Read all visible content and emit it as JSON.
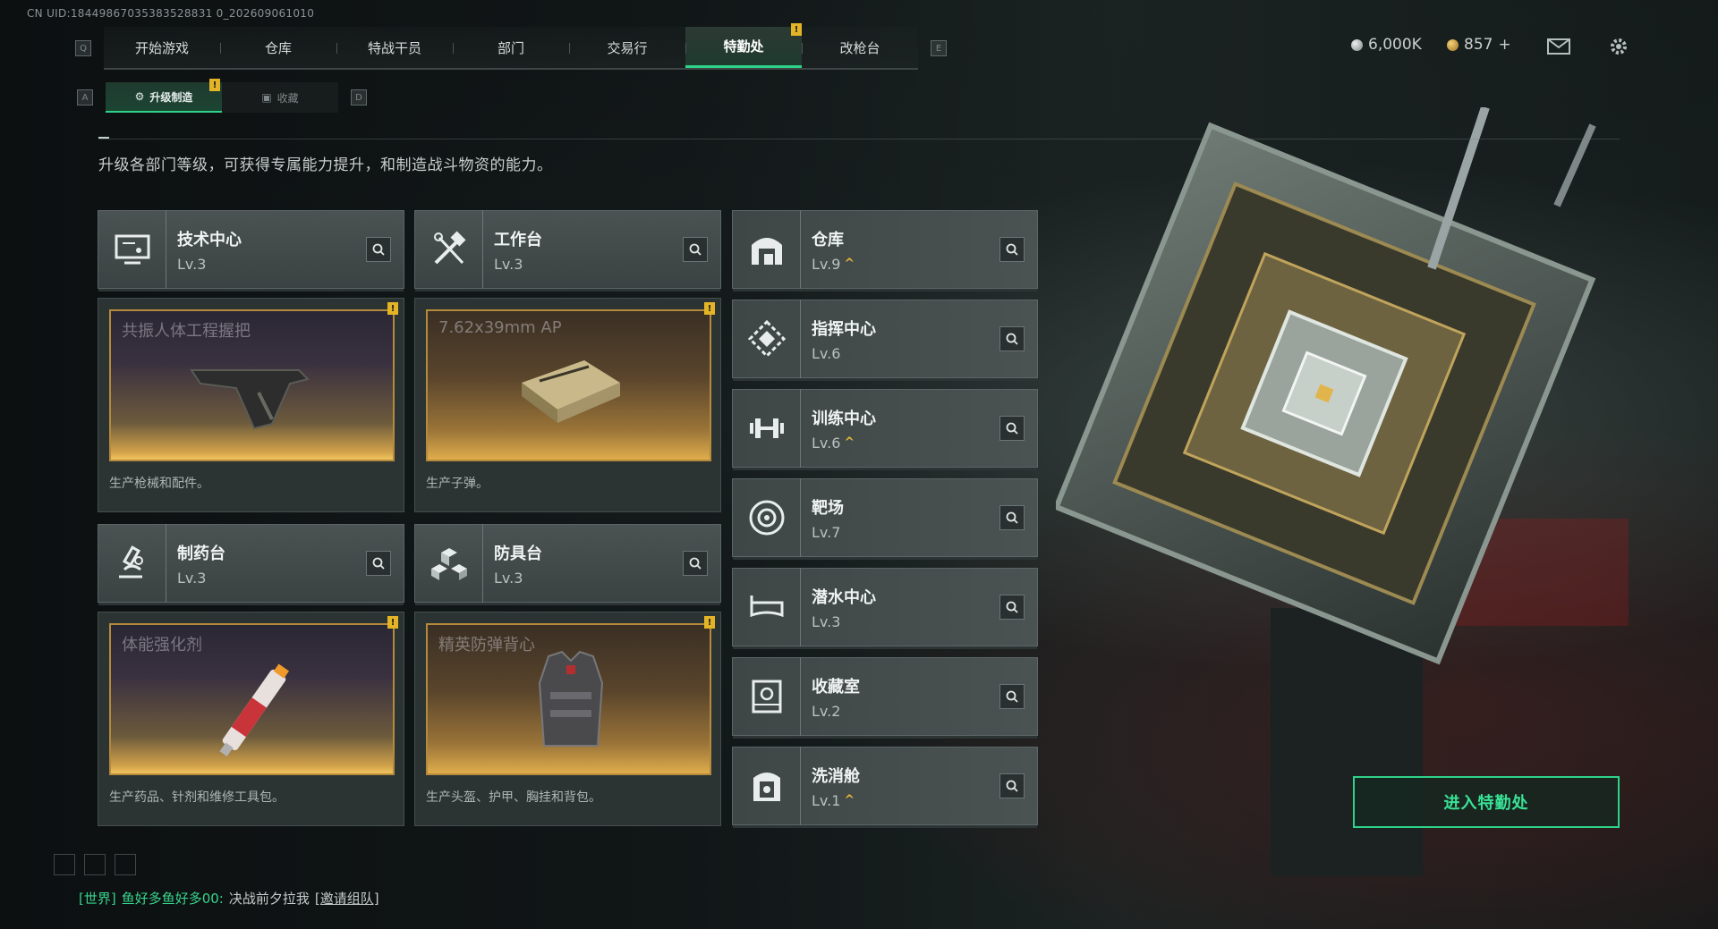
{
  "uid": "CN UID:18449867035383528831 0_202609061010",
  "nav": {
    "left_key": "Q",
    "right_key": "E",
    "tabs": [
      "开始游戏",
      "仓库",
      "特战干员",
      "部门",
      "交易行",
      "特勤处",
      "改枪台"
    ],
    "active_tab_index": 5,
    "active_tab_badge": "!"
  },
  "currency": {
    "silver": "6,000K",
    "gold": "857",
    "gold_plus": "+"
  },
  "subnav": {
    "left_key": "A",
    "right_key": "D",
    "tabs": [
      {
        "label": "升级制造",
        "badge": "!",
        "active": true
      },
      {
        "label": "收藏",
        "badge": "",
        "active": false
      }
    ]
  },
  "description": "升级各部门等级，可获得专属能力提升，和制造战斗物资的能力。",
  "left_cards": [
    {
      "name": "技术中心",
      "level": "Lv.3",
      "icon": "tech-center-icon",
      "product": "共振人体工程握把",
      "product_desc": "生产枪械和配件。",
      "badge": "!"
    },
    {
      "name": "工作台",
      "level": "Lv.3",
      "icon": "workbench-icon",
      "product": "7.62x39mm AP",
      "product_desc": "生产子弹。",
      "badge": "!"
    },
    {
      "name": "制药台",
      "level": "Lv.3",
      "icon": "pharmacy-icon",
      "product": "体能强化剂",
      "product_desc": "生产药品、针剂和维修工具包。",
      "badge": "!"
    },
    {
      "name": "防具台",
      "level": "Lv.3",
      "icon": "armor-bench-icon",
      "product": "精英防弹背心",
      "product_desc": "生产头盔、护甲、胸挂和背包。",
      "badge": "!"
    }
  ],
  "right_cards": [
    {
      "name": "仓库",
      "level": "Lv.9",
      "upgrade": "^",
      "icon": "storage-icon"
    },
    {
      "name": "指挥中心",
      "level": "Lv.6",
      "upgrade": "",
      "icon": "command-center-icon"
    },
    {
      "name": "训练中心",
      "level": "Lv.6",
      "upgrade": "^",
      "icon": "training-center-icon"
    },
    {
      "name": "靶场",
      "level": "Lv.7",
      "upgrade": "",
      "icon": "shooting-range-icon"
    },
    {
      "name": "潜水中心",
      "level": "Lv.3",
      "upgrade": "",
      "icon": "diving-center-icon"
    },
    {
      "name": "收藏室",
      "level": "Lv.2",
      "upgrade": "",
      "icon": "collection-room-icon"
    },
    {
      "name": "洗消舱",
      "level": "Lv.1",
      "upgrade": "^",
      "icon": "decontamination-icon"
    }
  ],
  "enter_button": "进入特勤处",
  "chat": {
    "channel": "[世界]",
    "name": "鱼好多鱼好多00:",
    "message": "决战前夕拉我",
    "link": "[邀请组队]"
  },
  "colors": {
    "accent": "#2ed38a",
    "badge": "#e4b427",
    "upgrade": "#e2b43a"
  }
}
